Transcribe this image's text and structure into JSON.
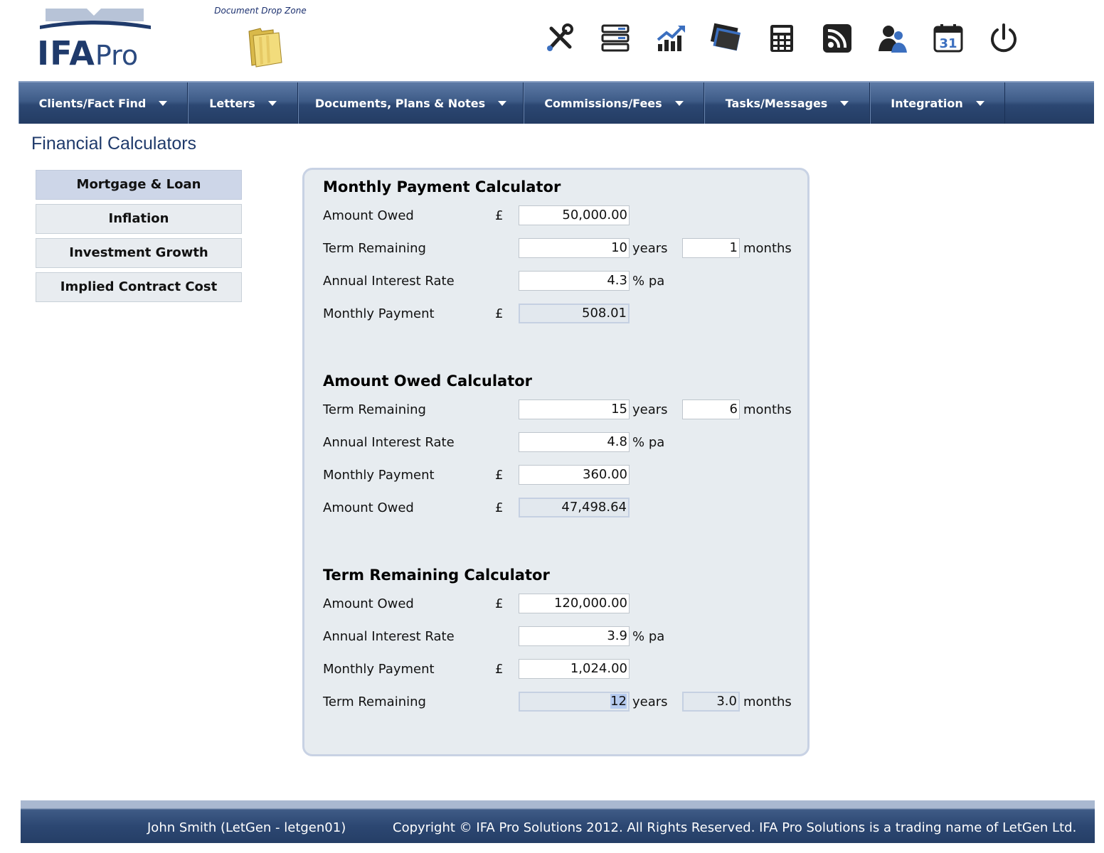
{
  "app": {
    "logo_text_bold": "IFA",
    "logo_text_light": "Pro",
    "drop_zone_label": "Document Drop Zone"
  },
  "toolbar": {
    "icons": [
      "tools-icon",
      "server-icon",
      "growth-chart-icon",
      "banknotes-icon",
      "calculator-icon",
      "rss-icon",
      "users-icon",
      "calendar-icon",
      "power-icon"
    ],
    "calendar_day": "31"
  },
  "nav": {
    "items": [
      {
        "label": "Clients/Fact Find"
      },
      {
        "label": "Letters"
      },
      {
        "label": "Documents, Plans & Notes"
      },
      {
        "label": "Commissions/Fees"
      },
      {
        "label": "Tasks/Messages"
      },
      {
        "label": "Integration"
      }
    ]
  },
  "page": {
    "title": "Financial Calculators"
  },
  "sidemenu": {
    "items": [
      {
        "label": "Mortgage & Loan",
        "active": true
      },
      {
        "label": "Inflation",
        "active": false
      },
      {
        "label": "Investment Growth",
        "active": false
      },
      {
        "label": "Implied Contract Cost",
        "active": false
      }
    ]
  },
  "calc": {
    "currency": "£",
    "monthly_payment": {
      "title": "Monthly Payment Calculator",
      "amount_owed_label": "Amount Owed",
      "amount_owed": "50,000.00",
      "term_label": "Term Remaining",
      "term_years": "10",
      "years_unit": "years",
      "term_months": "1",
      "months_unit": "months",
      "rate_label": "Annual Interest Rate",
      "rate": "4.3",
      "rate_unit": "% pa",
      "payment_label": "Monthly Payment",
      "payment": "508.01"
    },
    "amount_owed": {
      "title": "Amount Owed Calculator",
      "term_label": "Term Remaining",
      "term_years": "15",
      "years_unit": "years",
      "term_months": "6",
      "months_unit": "months",
      "rate_label": "Annual Interest Rate",
      "rate": "4.8",
      "rate_unit": "% pa",
      "payment_label": "Monthly Payment",
      "payment": "360.00",
      "owed_label": "Amount Owed",
      "owed": "47,498.64"
    },
    "term_remaining": {
      "title": "Term Remaining Calculator",
      "amount_owed_label": "Amount Owed",
      "amount_owed": "120,000.00",
      "rate_label": "Annual Interest Rate",
      "rate": "3.9",
      "rate_unit": "% pa",
      "payment_label": "Monthly Payment",
      "payment": "1,024.00",
      "term_label": "Term Remaining",
      "term_years": "12",
      "years_unit": "years",
      "term_months": "3.0",
      "months_unit": "months"
    }
  },
  "footer": {
    "user": "John Smith (LetGen - letgen01)",
    "copyright": "Copyright © IFA Pro Solutions 2012. All Rights Reserved. IFA Pro Solutions is a trading name of LetGen Ltd."
  },
  "colors": {
    "brand_navy": "#1f3a6b",
    "nav_top": "#5d7aa6",
    "nav_bottom": "#233c63",
    "panel_bg": "#e7ecf0",
    "active_menu": "#cdd6e8"
  }
}
